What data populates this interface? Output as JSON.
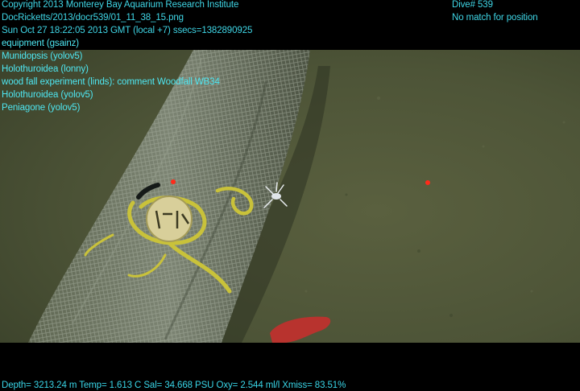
{
  "header": {
    "copyright": "Copyright 2013 Monterey Bay Aquarium Research Institute",
    "filename": "DocRicketts/2013/docr539/01_11_38_15.png",
    "timestamp": "Sun Oct 27 18:22:05 2013 GMT (local +7)  ssecs=1382890925",
    "dive": "Dive# 539",
    "position_status": "No match for position"
  },
  "annotations": [
    "equipment (gsainz)",
    "Munidopsis (yolov5)",
    "Holothuroidea (lonny)",
    "wood fall experiment (linds): comment Woodfall WB34",
    "Holothuroidea (yolov5)",
    "Peniagone (yolov5)"
  ],
  "footer": {
    "telemetry": "Depth= 3213.24 m  Temp= 1.613 C  Sal= 34.668 PSU  Oxy= 2.544 ml/l  Xmiss= 83.51%"
  },
  "colors": {
    "overlay_text": "#3fd6e6",
    "seafloor": "#4f5637",
    "mesh": "#8a9488",
    "rope": "#c9c23a",
    "laser": "#ff2a1a",
    "holothurian": "#b8332e"
  }
}
